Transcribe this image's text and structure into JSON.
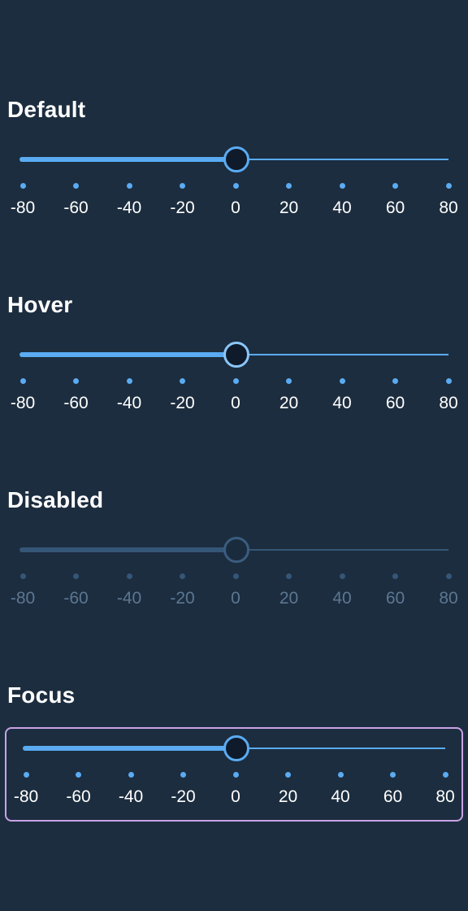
{
  "colors": {
    "background": "#1c2d3f",
    "accent": "#5aabf2",
    "thumb_fill": "#0f1a2b",
    "disabled": "#355677",
    "focus_ring": "#c9a3e6"
  },
  "ticks": [
    "-80",
    "-60",
    "-40",
    "-20",
    "0",
    "20",
    "40",
    "60",
    "80"
  ],
  "sliders": [
    {
      "label": "Default",
      "value": 0,
      "min": -80,
      "max": 80,
      "state": "default"
    },
    {
      "label": "Hover",
      "value": 0,
      "min": -80,
      "max": 80,
      "state": "hover"
    },
    {
      "label": "Disabled",
      "value": 0,
      "min": -80,
      "max": 80,
      "state": "disabled"
    },
    {
      "label": "Focus",
      "value": 0,
      "min": -80,
      "max": 80,
      "state": "focus"
    }
  ]
}
